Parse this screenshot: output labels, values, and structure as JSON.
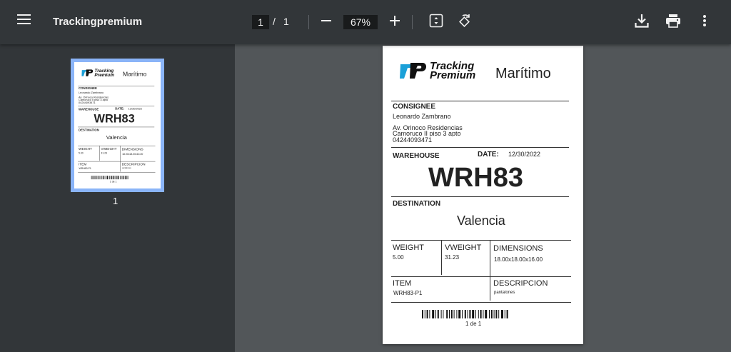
{
  "toolbar": {
    "title": "Trackingpremium",
    "current_page": "1",
    "page_separator": "/",
    "total_pages": "1",
    "zoom": "67%"
  },
  "sidebar": {
    "thumbnail_label": "1"
  },
  "label": {
    "brand_line1": "Tracking",
    "brand_line2": "Premium",
    "service": "Marítimo",
    "consignee_heading": "CONSIGNEE",
    "consignee_name": "Leonardo Zambrano",
    "address_line1": "Av. Orinoco Residencias",
    "address_line2": "Camoruco II piso 3 apto",
    "phone": "04244093471",
    "warehouse_heading": "WAREHOUSE",
    "date_heading": "DATE:",
    "date_value": "12/30/2022",
    "warehouse_code": "WRH83",
    "destination_heading": "DESTINATION",
    "destination_value": "Valencia",
    "weight_heading": "WEIGHT",
    "weight_value": "5.00",
    "vweight_heading": "VWEIGHT",
    "vweight_value": "31.23",
    "dimensions_heading": "DIMENSIONS",
    "dimensions_value": "18.00x18.00x16.00",
    "item_heading": "ITEM",
    "item_value": "WRH83-P1",
    "description_heading": "DESCRIPCION",
    "description_value": "pantalones",
    "barcode_caption": "1 de 1"
  },
  "colors": {
    "toolbar_bg": "#323639",
    "viewer_bg": "#525659",
    "thumb_selected": "#8ab4f8",
    "logo_blue": "#1aa0d8",
    "logo_dark": "#111111"
  },
  "icons": [
    "menu-icon",
    "zoom-out-icon",
    "zoom-in-icon",
    "fit-page-icon",
    "rotate-icon",
    "download-icon",
    "print-icon",
    "more-vert-icon"
  ]
}
